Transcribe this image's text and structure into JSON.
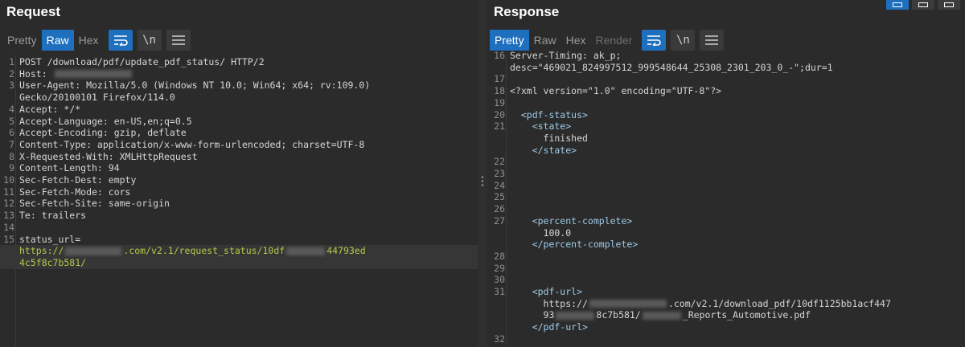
{
  "request": {
    "title": "Request",
    "tabs": [
      "Pretty",
      "Raw",
      "Hex"
    ],
    "active_tab": "Raw",
    "icons": {
      "wrap": "wrap-lines-icon",
      "newline": "\\n",
      "menu": "hamburger-menu-icon"
    },
    "lines": [
      {
        "n": "1",
        "text": "POST /download/pdf/update_pdf_status/ HTTP/2"
      },
      {
        "n": "2",
        "text": "Host: "
      },
      {
        "n": "3",
        "text": "User-Agent: Mozilla/5.0 (Windows NT 10.0; Win64; x64; rv:109.0)"
      },
      {
        "n": "",
        "text": "Gecko/20100101 Firefox/114.0"
      },
      {
        "n": "4",
        "text": "Accept: */*"
      },
      {
        "n": "5",
        "text": "Accept-Language: en-US,en;q=0.5"
      },
      {
        "n": "6",
        "text": "Accept-Encoding: gzip, deflate"
      },
      {
        "n": "7",
        "text": "Content-Type: application/x-www-form-urlencoded; charset=UTF-8"
      },
      {
        "n": "8",
        "text": "X-Requested-With: XMLHttpRequest"
      },
      {
        "n": "9",
        "text": "Content-Length: 94"
      },
      {
        "n": "10",
        "text": "Sec-Fetch-Dest: empty"
      },
      {
        "n": "11",
        "text": "Sec-Fetch-Mode: cors"
      },
      {
        "n": "12",
        "text": "Sec-Fetch-Site: same-origin"
      },
      {
        "n": "13",
        "text": "Te: trailers"
      },
      {
        "n": "14",
        "text": ""
      },
      {
        "n": "15",
        "text": "status_url="
      }
    ],
    "url_line_1_a": "https://",
    "url_line_1_b": ".com/v2.1/request_status/10df",
    "url_line_1_c": "44793ed",
    "url_line_2": "4c5f8c7b581/"
  },
  "response": {
    "title": "Response",
    "tabs": [
      "Pretty",
      "Raw",
      "Hex",
      "Render"
    ],
    "active_tab": "Pretty",
    "disabled_tab": "Render",
    "lines": [
      {
        "n": "16",
        "text": "Server-Timing: ak_p;",
        "cls": ""
      },
      {
        "n": "",
        "text": "desc=\"469021_824997512_999548644_25308_2301_203_0_-\";dur=1",
        "cls": ""
      },
      {
        "n": "17",
        "text": "",
        "cls": ""
      },
      {
        "n": "18",
        "text": "<?xml version=\"1.0\" encoding=\"UTF-8\"?>",
        "cls": ""
      },
      {
        "n": "19",
        "text": "",
        "cls": ""
      },
      {
        "n": "20",
        "text": "  <pdf-status>",
        "cls": "xml-tag"
      },
      {
        "n": "21",
        "text": "    <state>",
        "cls": "xml-tag"
      },
      {
        "n": "",
        "text": "      finished",
        "cls": ""
      },
      {
        "n": "",
        "text": "    </state>",
        "cls": "xml-tag"
      },
      {
        "n": "22",
        "text": "",
        "cls": ""
      },
      {
        "n": "23",
        "text": "",
        "cls": ""
      },
      {
        "n": "24",
        "text": "",
        "cls": ""
      },
      {
        "n": "25",
        "text": "",
        "cls": ""
      },
      {
        "n": "26",
        "text": "",
        "cls": ""
      },
      {
        "n": "27",
        "text": "    <percent-complete>",
        "cls": "xml-tag"
      },
      {
        "n": "",
        "text": "      100.0",
        "cls": ""
      },
      {
        "n": "",
        "text": "    </percent-complete>",
        "cls": "xml-tag"
      },
      {
        "n": "28",
        "text": "",
        "cls": ""
      },
      {
        "n": "29",
        "text": "",
        "cls": ""
      },
      {
        "n": "30",
        "text": "",
        "cls": ""
      },
      {
        "n": "31",
        "text": "    <pdf-url>",
        "cls": "xml-tag"
      }
    ],
    "pdf_url_a": "      https://",
    "pdf_url_b": ".com/v2.1/download_pdf/10df1125bb1acf447",
    "pdf_url_c": "      93",
    "pdf_url_d": "8c7b581/",
    "pdf_url_e": "_Reports_Automotive.pdf",
    "pdf_url_close": "    </pdf-url>",
    "last_n": "32"
  }
}
